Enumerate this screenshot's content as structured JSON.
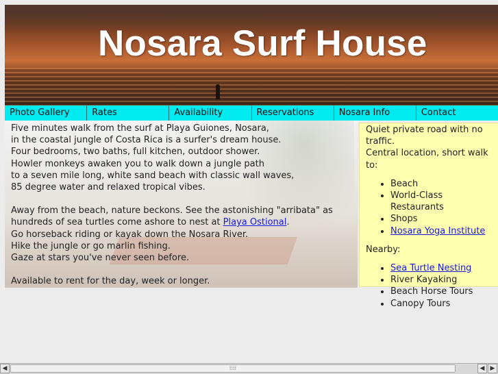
{
  "banner": {
    "title": "Nosara Surf House"
  },
  "nav": [
    "Photo Gallery",
    "Rates",
    "Availability",
    "Reservations",
    "Nosara Info",
    "Contact"
  ],
  "main": {
    "para1": [
      "Five minutes walk from the surf at Playa Guiones, Nosara,",
      "in the coastal jungle of Costa Rica is a surfer's dream house.",
      "Four bedrooms, two baths, full kitchen, outdoor shower.",
      "Howler monkeys awaken you to walk down a jungle path",
      "to a seven mile long, white sand beach with classic wall waves,",
      "85 degree water and relaxed tropical vibes."
    ],
    "para2_line1": "Away from the beach, nature beckons. See the astonishing \"arribata\" as",
    "para2_line2_prefix": "hundreds of sea turtles come ashore to nest at ",
    "para2_line2_link": "Playa Ostional",
    "para2_line2_suffix": ".",
    "para2_rest": [
      "Go horseback riding or kayak down the Nosara River.",
      "Hike the jungle or go marlin fishing.",
      "Gaze at stars you've never seen before."
    ],
    "para3": "Available to rent for the day, week or longer."
  },
  "side": {
    "intro1": "Quiet private road with no traffic.",
    "intro2": "Central location, short walk to:",
    "list1": [
      {
        "text": "Beach",
        "link": false
      },
      {
        "text": "World-Class Restaurants",
        "link": false
      },
      {
        "text": "Shops",
        "link": false
      },
      {
        "text": "Nosara Yoga Institute",
        "link": true
      }
    ],
    "nearby": "Nearby:",
    "list2": [
      {
        "text": "Sea Turtle Nesting",
        "link": true
      },
      {
        "text": "River Kayaking",
        "link": false
      },
      {
        "text": "Beach Horse Tours",
        "link": false
      },
      {
        "text": "Canopy Tours",
        "link": false
      }
    ]
  },
  "scrollbar": {
    "left_arrow": "◀",
    "right_arrow": "▶",
    "grip": "⁞⁞⁞⁞"
  }
}
